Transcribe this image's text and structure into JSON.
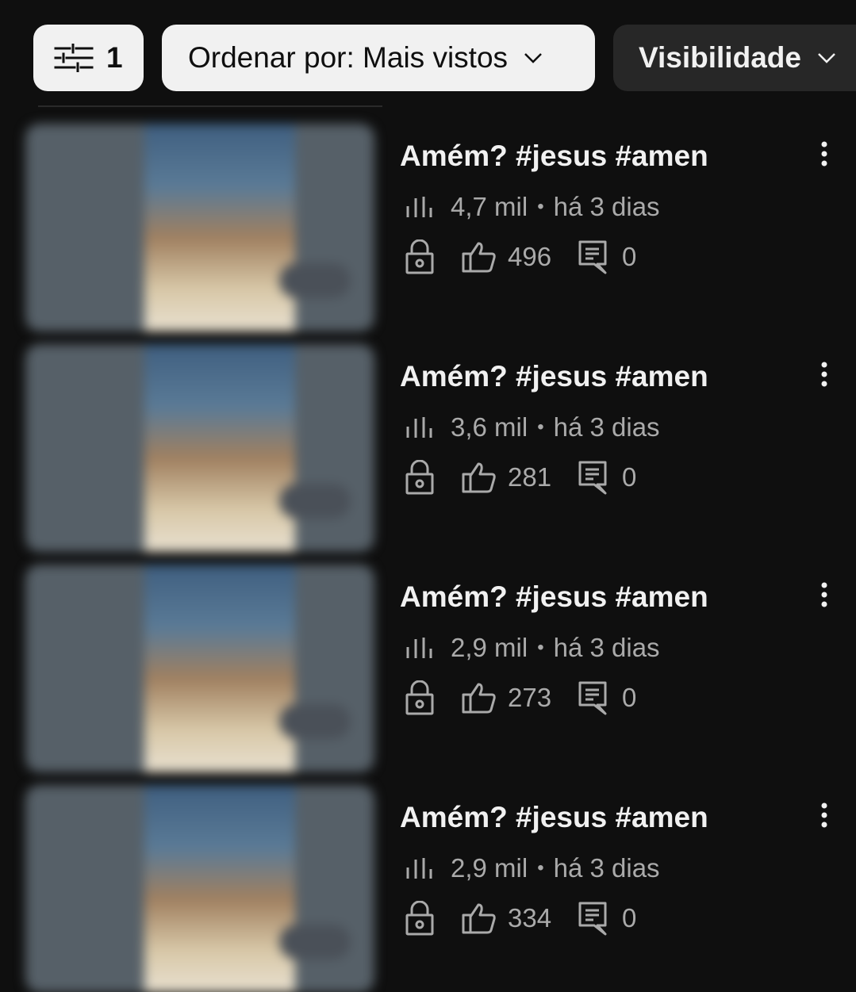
{
  "filters": {
    "filter_count": "1",
    "sort_label": "Ordenar por: Mais vistos",
    "visibility_label": "Visibilidade"
  },
  "videos": [
    {
      "title": "Amém? #jesus #amen",
      "views": "4,7 mil",
      "separator": "•",
      "age": "há 3 dias",
      "likes": "496",
      "comments": "0"
    },
    {
      "title": "Amém? #jesus #amen",
      "views": "3,6 mil",
      "separator": "•",
      "age": "há 3 dias",
      "likes": "281",
      "comments": "0"
    },
    {
      "title": "Amém? #jesus #amen",
      "views": "2,9 mil",
      "separator": "•",
      "age": "há 3 dias",
      "likes": "273",
      "comments": "0"
    },
    {
      "title": "Amém? #jesus #amen",
      "views": "2,9 mil",
      "separator": "•",
      "age": "há 3 dias",
      "likes": "334",
      "comments": "0"
    }
  ],
  "icons": {
    "filter": "sliders-icon",
    "chevron": "chevron-down-icon",
    "views": "bar-chart-icon",
    "visibility": "lock-icon",
    "likes": "thumbs-up-icon",
    "comments": "comment-icon",
    "more": "more-vert-icon"
  },
  "colors": {
    "background": "#0f0f0f",
    "chip_light": "#f1f1f1",
    "chip_dark": "#272727",
    "secondary_text": "#aaaaaa"
  }
}
